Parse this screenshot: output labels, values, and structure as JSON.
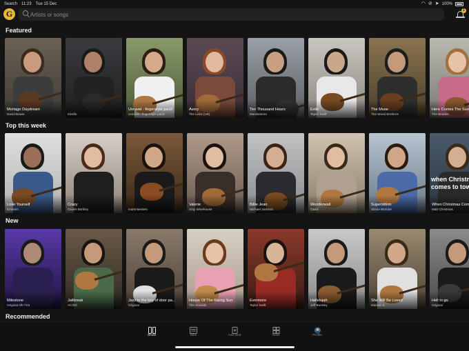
{
  "status": {
    "back_app": "Search",
    "time": "11:23",
    "date": "Tue 15 Dec",
    "battery": "100%"
  },
  "app": {
    "logo_letter": "G",
    "accent": "#e7b53a",
    "notification_count": "1"
  },
  "search": {
    "placeholder": "Artists or songs",
    "value": ""
  },
  "sections": [
    {
      "title": "Featured",
      "cards": [
        {
          "title": "Mortage Daydream",
          "artist": "David Bowie"
        },
        {
          "title": "",
          "artist": "Kitsillo"
        },
        {
          "title": "Unravel - fingerstyle part3",
          "artist": "Unravel - fingerstyle part3"
        },
        {
          "title": "Avery",
          "artist": "The Licks (US)"
        },
        {
          "title": "Ten Thousand Hours",
          "artist": "Macklemore"
        },
        {
          "title": "Exile",
          "artist": "Taylor Swift"
        },
        {
          "title": "The Muse",
          "artist": "The Wood Brothers"
        },
        {
          "title": "Here Comes The Sun",
          "artist": "The Beatles"
        }
      ]
    },
    {
      "title": "Top this week",
      "cards": [
        {
          "title": "Lose Yourself",
          "artist": "Eminem"
        },
        {
          "title": "Crazy",
          "artist": "Gnarls Barkley"
        },
        {
          "title": "",
          "artist": "marshlaeders"
        },
        {
          "title": "Valerie",
          "artist": "Amy Winehouse"
        },
        {
          "title": "Billie Jean",
          "artist": "Michael Jackson"
        },
        {
          "title": "Wonderwall",
          "artist": "Oasis"
        },
        {
          "title": "Superstition",
          "artist": "Stevie Wonder"
        },
        {
          "title": "When Christmas Comes To Town",
          "artist": "Matt Christmas",
          "overlay": "when Christmas comes to town"
        }
      ]
    },
    {
      "title": "New",
      "cards": [
        {
          "title": "Milestone",
          "artist": "Original Aftr Fire"
        },
        {
          "title": "Jailbreak",
          "artist": "AC/DC"
        },
        {
          "title": "Jazz in the key of door pa...",
          "artist": "Original"
        },
        {
          "title": "House Of The Rising Sun",
          "artist": "The Animals"
        },
        {
          "title": "Evermore",
          "artist": "Taylor Swift"
        },
        {
          "title": "Hallelujah",
          "artist": "Jeff Buckley"
        },
        {
          "title": "She Will Be Loved",
          "artist": "Maroon 5"
        },
        {
          "title": "Hell to go",
          "artist": "Original"
        }
      ]
    },
    {
      "title": "Recommended",
      "cards": []
    }
  ],
  "tabs": [
    {
      "label": "Shots",
      "icon": "shots-icon",
      "active": true
    },
    {
      "label": "Tabs",
      "icon": "tabs-icon",
      "active": false
    },
    {
      "label": "Add shot",
      "icon": "add-shot-icon",
      "active": false
    },
    {
      "label": "Tools",
      "icon": "tools-icon",
      "active": false
    },
    {
      "label": "Profile",
      "icon": "profile-icon",
      "active": false
    }
  ]
}
